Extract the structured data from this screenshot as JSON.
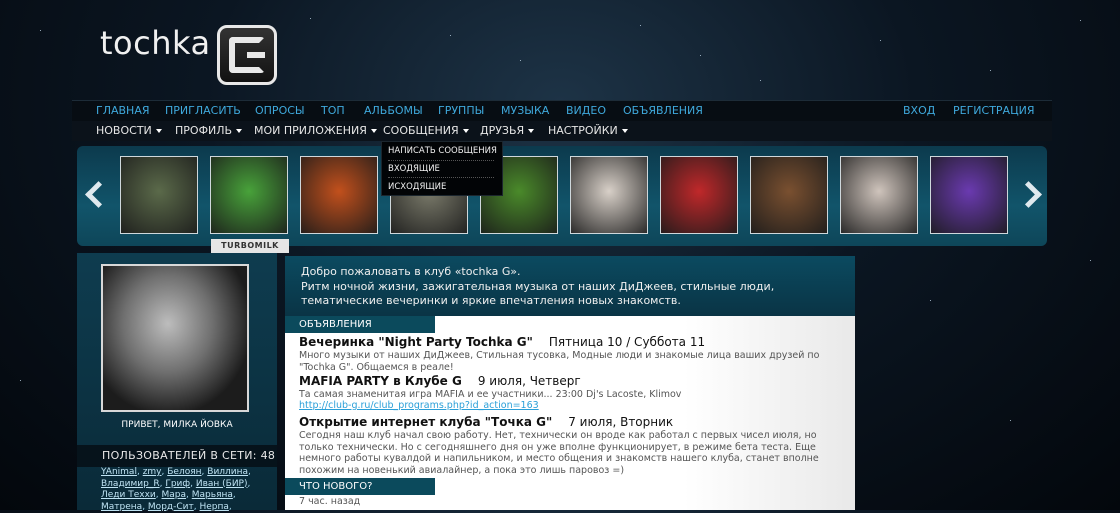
{
  "brand": {
    "logo_text": "tochka"
  },
  "nav_primary": [
    "ГЛАВНАЯ",
    "ПРИГЛАСИТЬ",
    "ОПРОСЫ",
    "ТОП",
    "АЛЬБОМЫ",
    "ГРУППЫ",
    "МУЗЫКА",
    "ВИДЕО",
    "ОБЪЯВЛЕНИЯ"
  ],
  "nav_auth": {
    "login": "ВХОД",
    "register": "РЕГИСТРАЦИЯ"
  },
  "nav_secondary": [
    "НОВОСТИ",
    "ПРОФИЛЬ",
    "МОИ ПРИЛОЖЕНИЯ",
    "СООБЩЕНИЯ",
    "ДРУЗЬЯ",
    "НАСТРОЙКИ"
  ],
  "messages_dropdown": [
    "НАПИСАТЬ СООБЩЕНИЯ",
    "ВХОДЯЩИЕ",
    "ИСХОДЯЩИЕ"
  ],
  "carousel": {
    "hover_label": "TURBOMILK",
    "thumb_colors": [
      "#5b6a4a",
      "#48a23a",
      "#c2501c",
      "#7b7b6b",
      "#4a8a2a",
      "#d8d0c8",
      "#c0282a",
      "#7a5030",
      "#cfc4bc",
      "#6a3ab0"
    ]
  },
  "sidebar": {
    "greeting": "ПРИВЕТ, МИЛКА ЙОВКА",
    "online_title": "ПОЛЬЗОВАТЕЛЕЙ В СЕТИ: 48",
    "users": [
      [
        "YAnimal",
        "zmy",
        "Белоян",
        "Виллина"
      ],
      [
        "Владимир_R",
        "Гриф",
        "Иван (БИР)"
      ],
      [
        "Леди Теххи",
        "Мара",
        "Марьяна"
      ],
      [
        "Матрена",
        "Морд-Сит",
        "Нерпа"
      ]
    ]
  },
  "welcome": {
    "line1": "Добро пожаловать  в клуб «tochka G».",
    "line2": "Ритм ночной жизни, зажигательная музыка от наших ДиДжеев, стильные люди,",
    "line3": "тематические вечеринки и яркие впечатления новых знакомств."
  },
  "announcements_tab": "ОБЪЯВЛЕНИЯ",
  "announcements": [
    {
      "title": "Вечеринка \"Night Party Tochka G\"",
      "date": "Пятница 10 / Суббота 11",
      "text": "Много музыки от наших ДиДжеев, Стильная тусовка, Модные люди и знакомые лица ваших друзей по \"Tochka G\". Общаемся в реале!"
    },
    {
      "title": "MAFIA PARTY в Клубе G",
      "date": "9 июля, Четверг",
      "text": "Та самая знаменитая игра MAFIA и ее участники... 23:00 Dj's Lacoste, Klimov",
      "link": "http://club-g.ru/club_programs.php?id_action=163"
    },
    {
      "title": "Открытие интернет клуба \"Точка G\"",
      "date": "7 июля, Вторник",
      "text": "Сегодня наш клуб начал свою работу. Нет, технически он вроде как работал с первых чисел июля, но только технически. Но с сегодняшнего дня он уже вполне функционирует, в режиме бета теста. Еще немного работы кувалдой и напильником, и место общения и знакомств нашего клуба, станет вполне похожим на новенький авиалайнер, а пока это лишь паровоз =)"
    }
  ],
  "news_tab": "ЧТО НОВОГО?",
  "news_time": "7 час. назад"
}
